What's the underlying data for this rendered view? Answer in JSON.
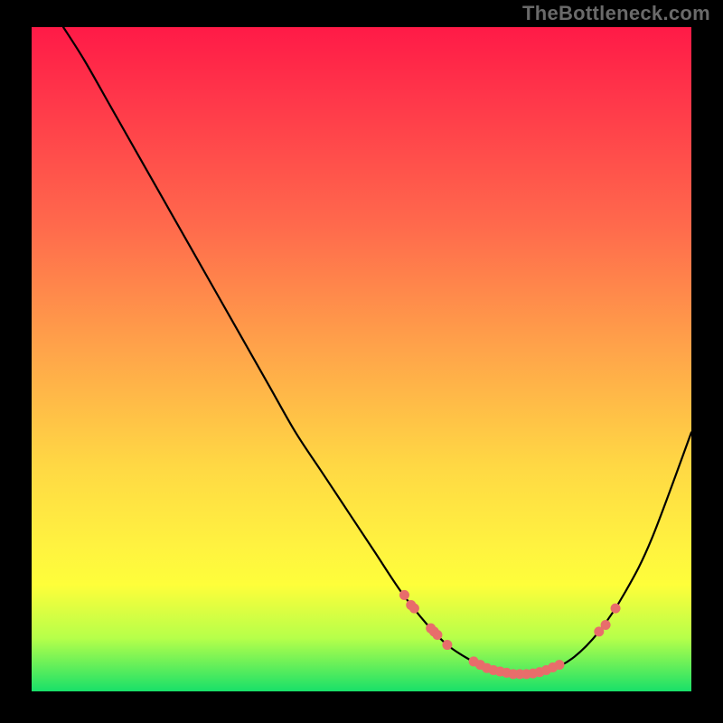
{
  "attribution": "TheBottleneck.com",
  "chart_data": {
    "type": "line",
    "title": "",
    "xlabel": "",
    "ylabel": "",
    "xlim": [
      0,
      100
    ],
    "ylim": [
      0,
      100
    ],
    "series": [
      {
        "name": "bottleneck-curve",
        "x": [
          4.8,
          8,
          12,
          16,
          20,
          24,
          28,
          32,
          36,
          40,
          44,
          48,
          52,
          56,
          60,
          63,
          66,
          70,
          74,
          78,
          82,
          86,
          90,
          94,
          100
        ],
        "y": [
          100,
          95,
          88,
          81,
          74,
          67,
          60,
          53,
          46,
          39,
          33,
          27,
          21,
          15,
          10,
          7,
          5,
          3,
          2.5,
          3,
          5,
          9,
          15,
          23,
          39
        ]
      }
    ],
    "scatter_points": {
      "name": "highlighted-points",
      "color": "#e86d6b",
      "x": [
        56.5,
        57.5,
        58,
        60.5,
        61,
        61.5,
        63,
        67,
        68,
        69,
        70,
        71,
        72,
        73,
        74,
        75,
        76,
        77,
        78,
        79,
        80,
        86,
        87,
        88.5
      ],
      "y": [
        14.5,
        13,
        12.5,
        9.5,
        9,
        8.5,
        7,
        4.5,
        4,
        3.5,
        3.2,
        3,
        2.8,
        2.6,
        2.6,
        2.6,
        2.7,
        2.9,
        3.2,
        3.6,
        4,
        9,
        10,
        12.5
      ]
    },
    "gradient_stops": [
      {
        "pos": 0,
        "color": "#ff1a47"
      },
      {
        "pos": 12,
        "color": "#ff3a4a"
      },
      {
        "pos": 30,
        "color": "#ff6a4c"
      },
      {
        "pos": 48,
        "color": "#ffa24a"
      },
      {
        "pos": 66,
        "color": "#ffd844"
      },
      {
        "pos": 78,
        "color": "#fff240"
      },
      {
        "pos": 84,
        "color": "#fefe3a"
      },
      {
        "pos": 92,
        "color": "#b6ff4a"
      },
      {
        "pos": 100,
        "color": "#18e069"
      }
    ]
  }
}
